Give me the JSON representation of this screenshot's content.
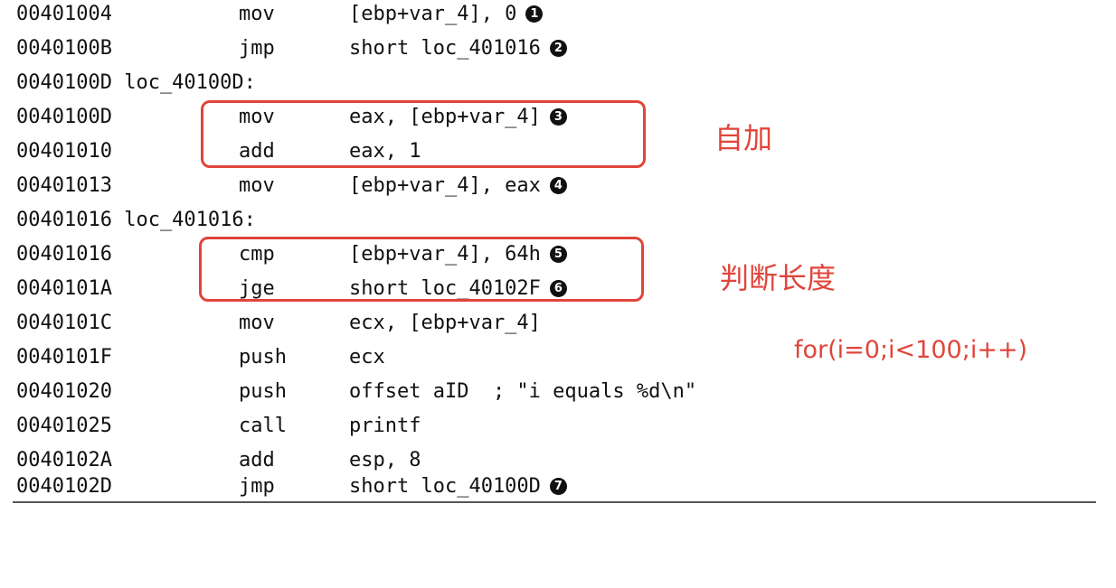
{
  "listing": [
    {
      "addr": "00401004",
      "mnemonic": "mov",
      "operands": "[ebp+var_4], 0",
      "marker": "1"
    },
    {
      "addr": "0040100B",
      "mnemonic": "jmp",
      "operands": "short loc_401016",
      "marker": "2"
    },
    {
      "label": "0040100D loc_40100D:"
    },
    {
      "addr": "0040100D",
      "mnemonic": "mov",
      "operands": "eax, [ebp+var_4]",
      "marker": "3"
    },
    {
      "addr": "00401010",
      "mnemonic": "add",
      "operands": "eax, 1"
    },
    {
      "addr": "00401013",
      "mnemonic": "mov",
      "operands": "[ebp+var_4], eax",
      "marker": "4"
    },
    {
      "label": "00401016 loc_401016:"
    },
    {
      "addr": "00401016",
      "mnemonic": "cmp",
      "operands": "[ebp+var_4], 64h",
      "marker": "5"
    },
    {
      "addr": "0040101A",
      "mnemonic": "jge",
      "operands": "short loc_40102F",
      "marker": "6"
    },
    {
      "addr": "0040101C",
      "mnemonic": "mov",
      "operands": "ecx, [ebp+var_4]"
    },
    {
      "addr": "0040101F",
      "mnemonic": "push",
      "operands": "ecx"
    },
    {
      "addr": "00401020",
      "mnemonic": "push",
      "operands": "offset aID  ; \"i equals %d\\n\""
    },
    {
      "addr": "00401025",
      "mnemonic": "call",
      "operands": "printf"
    },
    {
      "addr": "0040102A",
      "mnemonic": "add",
      "operands": "esp, 8"
    },
    {
      "addr": "0040102D",
      "mnemonic": "jmp",
      "operands": "short loc_40100D",
      "marker": "7"
    }
  ],
  "annotations": {
    "increment": "自加",
    "length_check": "判断长度",
    "for_loop": "for(i=0;i<100;i++)"
  },
  "colors": {
    "annotation": "#e0453a",
    "code": "#111111"
  }
}
